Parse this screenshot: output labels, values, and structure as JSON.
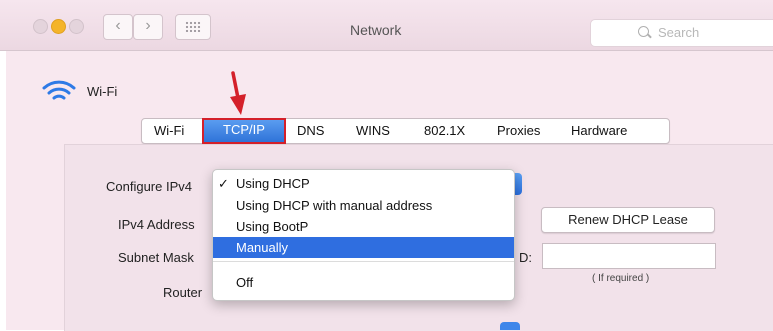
{
  "window": {
    "title": "Network",
    "search_placeholder": "Search"
  },
  "service": {
    "name": "Wi-Fi"
  },
  "tabs": [
    {
      "label": "Wi-Fi",
      "selected": false
    },
    {
      "label": "TCP/IP",
      "selected": true
    },
    {
      "label": "DNS",
      "selected": false
    },
    {
      "label": "WINS",
      "selected": false
    },
    {
      "label": "802.1X",
      "selected": false
    },
    {
      "label": "Proxies",
      "selected": false
    },
    {
      "label": "Hardware",
      "selected": false
    }
  ],
  "form": {
    "configure_label": "Configure IPv4",
    "address_label": "IPv4 Address",
    "subnet_label": "Subnet Mask",
    "router_label": "Router",
    "renew_button": "Renew DHCP Lease",
    "client_id_suffix": "D:",
    "client_id_value": "",
    "if_required": "( If required )"
  },
  "dropdown": {
    "selected_value": "Using DHCP",
    "highlighted": "Manually",
    "options": [
      {
        "label": "Using DHCP",
        "checked": true
      },
      {
        "label": "Using DHCP with manual address",
        "checked": false
      },
      {
        "label": "Using BootP",
        "checked": false
      },
      {
        "label": "Manually",
        "checked": false
      },
      {
        "label": "Off",
        "checked": false
      }
    ],
    "check_mark": "✓"
  },
  "colors": {
    "accent": "#2f6ee0",
    "annotation_red": "#d4202a",
    "window_tint": "#f8e8ef"
  },
  "icons": {
    "service": "wifi-icon",
    "nav_back": "chevron-left-icon",
    "nav_forward": "chevron-right-icon",
    "show_all": "grid-icon",
    "search": "search-icon"
  }
}
